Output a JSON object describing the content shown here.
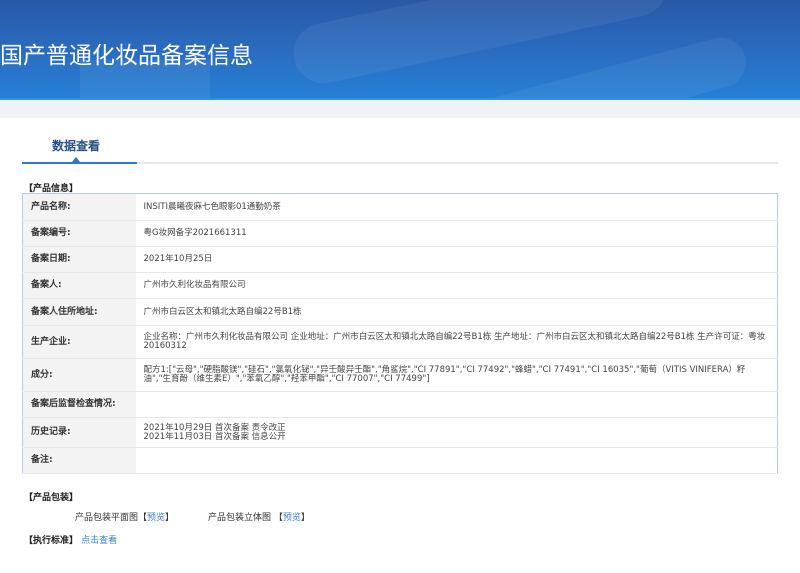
{
  "header": {
    "title": "国产普通化妆品备案信息"
  },
  "tabs": [
    {
      "label": "数据查看",
      "active": true
    }
  ],
  "product_info": {
    "section_label": "【产品信息】",
    "rows": [
      {
        "label": "产品名称:",
        "value": "INSITI晨曦夜麻七色眼影01通勤奶茶"
      },
      {
        "label": "备案编号:",
        "value": "粤G妆网备字2021661311"
      },
      {
        "label": "备案日期:",
        "value": "2021年10月25日"
      },
      {
        "label": "备案人:",
        "value": "广州市久利化妆品有限公司"
      },
      {
        "label": "备案人住所地址:",
        "value": "广州市白云区太和镇北太路自编22号B1栋"
      },
      {
        "label": "生产企业:",
        "value": "企业名称：广州市久利化妆品有限公司 企业地址：广州市白云区太和镇北太路自编22号B1栋 生产地址：广州市白云区太和镇北太路自编22号B1栋 生产许可证：粤妆20160312"
      },
      {
        "label": "成分:",
        "value": "配方1:[\"云母\",\"硬脂酸镁\",\"硅石\",\"氯氧化铋\",\"异壬酸异壬酯\",\"角鲨烷\",\"CI 77891\",\"CI 77492\",\"蜂蜡\",\"CI 77491\",\"CI 16035\",\"葡萄（VITIS VINIFERA）籽油\",\"生育酚（维生素E）\",\"苯氧乙醇\",\"羟苯甲酯\",\"CI 77007\",\"CI 77499\"]"
      },
      {
        "label": "备案后监督检查情况:",
        "value": ""
      },
      {
        "label": "历史记录:",
        "value": "2021年10月29日 首次备案 责令改正",
        "value2": "2021年11月03日 首次备案 信息公开"
      },
      {
        "label": "备注:",
        "value": ""
      }
    ]
  },
  "packaging": {
    "section_label": "【产品包装】",
    "flat_label": "产品包装平面图",
    "flat_link": "预览",
    "solid_label": "产品包装立体图",
    "solid_link": "预览",
    "bracket_open": "【",
    "bracket_close": "】"
  },
  "standard": {
    "section_label": "【执行标准】",
    "link": "点击查看"
  },
  "colors": {
    "header": "#2a6fc4",
    "accent": "#2a7bd0",
    "link": "#3a7fd0"
  }
}
